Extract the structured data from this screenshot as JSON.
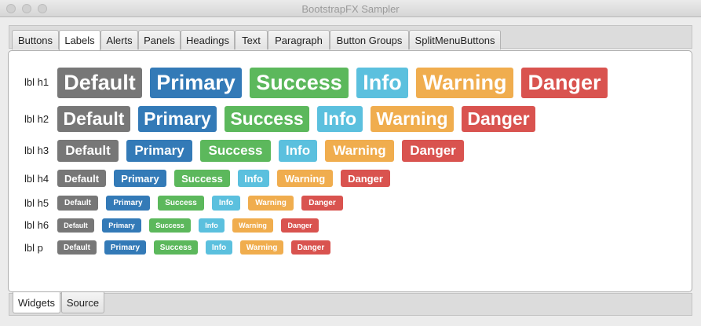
{
  "window": {
    "title": "BootstrapFX Sampler"
  },
  "top_tabs": [
    {
      "label": "Buttons"
    },
    {
      "label": "Labels"
    },
    {
      "label": "Alerts"
    },
    {
      "label": "Panels"
    },
    {
      "label": "Headings"
    },
    {
      "label": "Text"
    },
    {
      "label": "Paragraph"
    },
    {
      "label": "Button Groups"
    },
    {
      "label": "SplitMenuButtons"
    }
  ],
  "selected_top_tab": "Labels",
  "rows": [
    {
      "name": "lbl h1",
      "labels": [
        "Default",
        "Primary",
        "Success",
        "Info",
        "Warning",
        "Danger"
      ]
    },
    {
      "name": "lbl h2",
      "labels": [
        "Default",
        "Primary",
        "Success",
        "Info",
        "Warning",
        "Danger"
      ]
    },
    {
      "name": "lbl h3",
      "labels": [
        "Default",
        "Primary",
        "Success",
        "Info",
        "Warning",
        "Danger"
      ]
    },
    {
      "name": "lbl h4",
      "labels": [
        "Default",
        "Primary",
        "Success",
        "Info",
        "Warning",
        "Danger"
      ]
    },
    {
      "name": "lbl h5",
      "labels": [
        "Default",
        "Primary",
        "Success",
        "Info",
        "Warning",
        "Danger"
      ]
    },
    {
      "name": "lbl h6",
      "labels": [
        "Default",
        "Primary",
        "Success",
        "Info",
        "Warning",
        "Danger"
      ]
    },
    {
      "name": "lbl p",
      "labels": [
        "Default",
        "Primary",
        "Success",
        "Info",
        "Warning",
        "Danger"
      ]
    }
  ],
  "colors": {
    "default": "#777777",
    "primary": "#337ab7",
    "success": "#5cb85c",
    "info": "#5bc0de",
    "warning": "#f0ad4e",
    "danger": "#d9534f"
  },
  "bottom_tabs": [
    {
      "label": "Widgets"
    },
    {
      "label": "Source"
    }
  ],
  "selected_bottom_tab": "Widgets"
}
